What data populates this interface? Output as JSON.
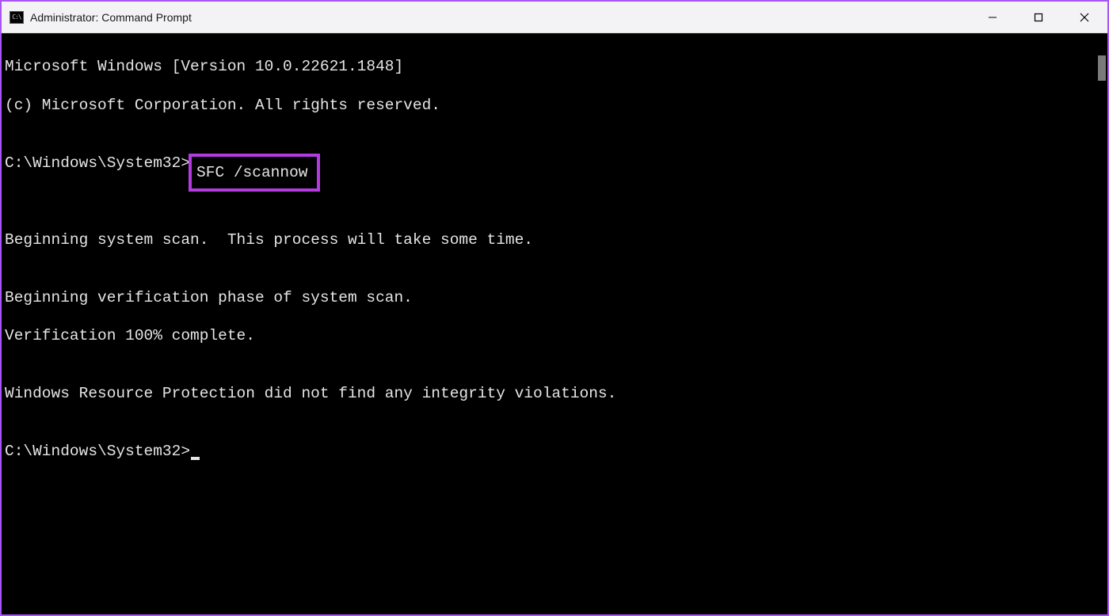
{
  "titlebar": {
    "icon_label": "C:\\",
    "title": "Administrator: Command Prompt"
  },
  "terminal": {
    "line1": "Microsoft Windows [Version 10.0.22621.1848]",
    "line2": "(c) Microsoft Corporation. All rights reserved.",
    "blank": "",
    "prompt1_path": "C:\\Windows\\System32>",
    "prompt1_cmd": "SFC /scannow",
    "line4": "Beginning system scan.  This process will take some time.",
    "line5": "Beginning verification phase of system scan.",
    "line6": "Verification 100% complete.",
    "line7": "Windows Resource Protection did not find any integrity violations.",
    "prompt2_path": "C:\\Windows\\System32>"
  }
}
